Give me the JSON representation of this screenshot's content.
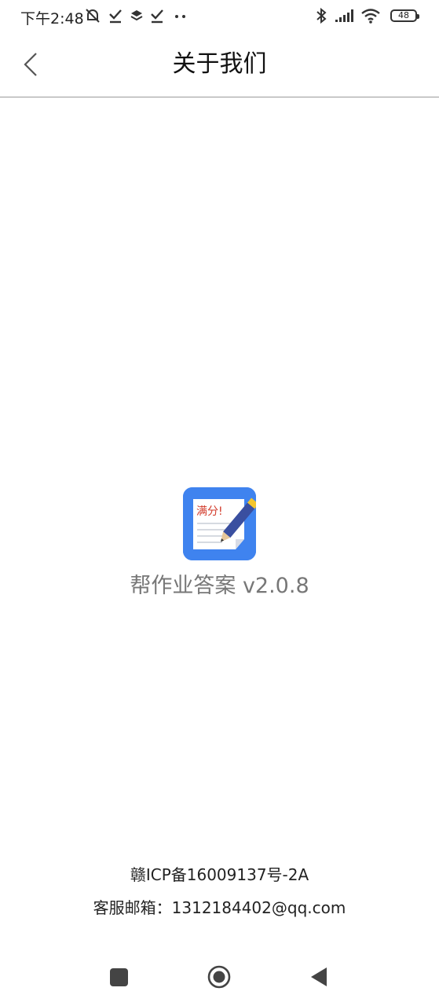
{
  "status_bar": {
    "time": "下午2:48",
    "battery": "48",
    "icons": [
      "mute-bell-icon",
      "check-icon",
      "layers-icon",
      "check-icon",
      "more-dots-icon",
      "bluetooth-icon",
      "signal-icon",
      "wifi-icon",
      "battery-icon"
    ]
  },
  "header": {
    "title": "关于我们",
    "back_icon": "chevron-left-icon"
  },
  "app": {
    "logo_text": "满分!",
    "name_version": "帮作业答案 v2.0.8",
    "colors": {
      "logo_bg": "#3f83ef",
      "pencil": "#3a4fa0",
      "eraser": "#f3c52d"
    }
  },
  "footer": {
    "icp": "赣ICP备16009137号-2A",
    "email": "客服邮箱：1312184402@qq.com"
  },
  "nav_bar": {
    "buttons": [
      "recents-square-icon",
      "home-circle-icon",
      "back-triangle-icon"
    ]
  }
}
